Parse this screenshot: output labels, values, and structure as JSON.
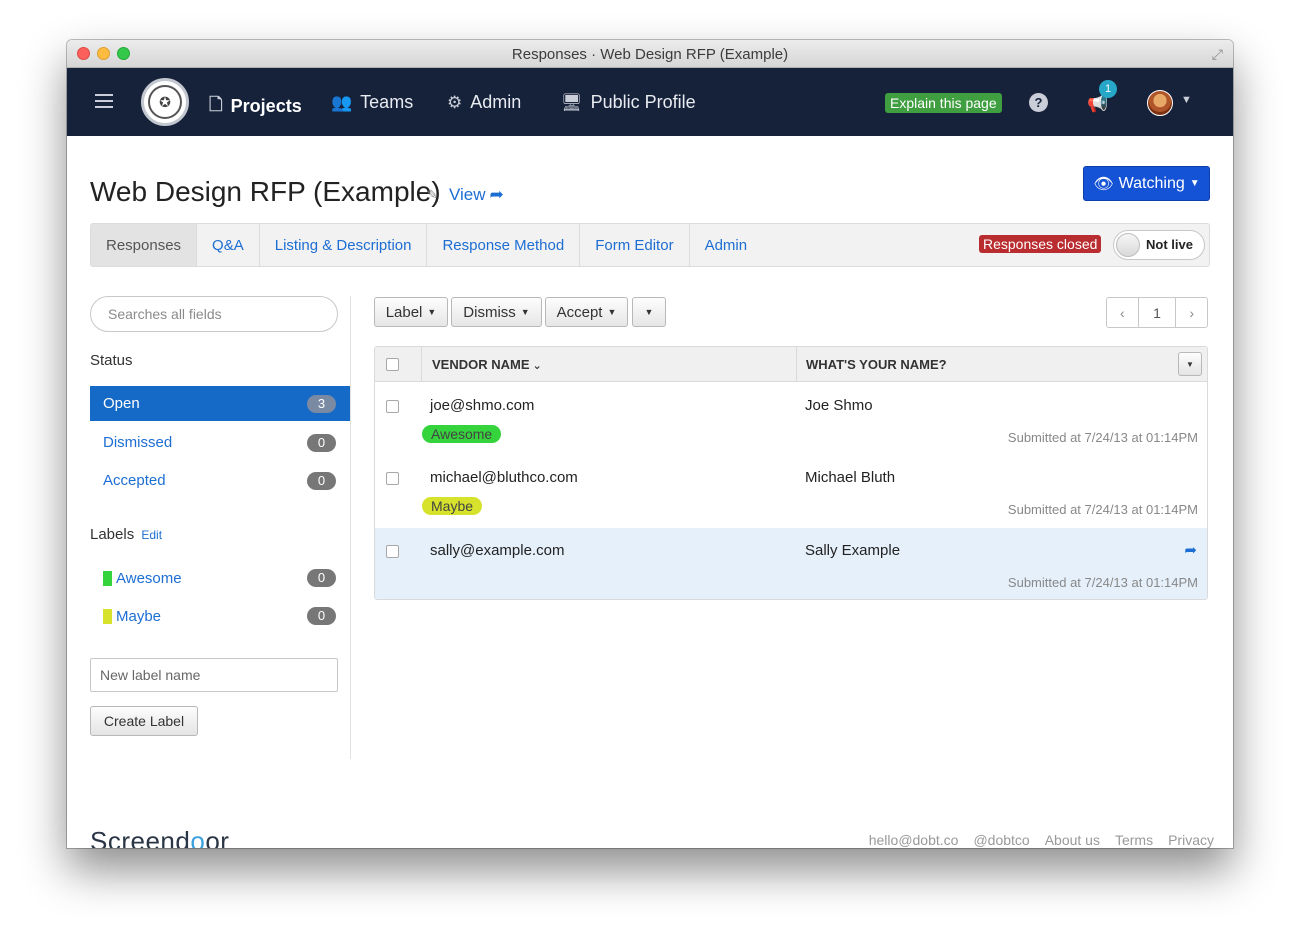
{
  "window": {
    "title": "Responses · Web Design RFP (Example)"
  },
  "navbar": {
    "items": [
      {
        "label": "Projects",
        "icon": "file-icon"
      },
      {
        "label": "Teams",
        "icon": "team-icon"
      },
      {
        "label": "Admin",
        "icon": "gear-icon"
      },
      {
        "label": "Public Profile",
        "icon": "monitor-icon"
      }
    ],
    "explain_label": "Explain this page",
    "notification_count": "1"
  },
  "header": {
    "title": "Web Design RFP (Example)",
    "view_label": "View",
    "watch_label": "Watching"
  },
  "tabs": [
    {
      "label": "Responses",
      "active": true
    },
    {
      "label": "Q&A"
    },
    {
      "label": "Listing & Description"
    },
    {
      "label": "Response Method"
    },
    {
      "label": "Form Editor"
    },
    {
      "label": "Admin"
    }
  ],
  "status_badge": "Responses closed",
  "live_toggle": "Not live",
  "sidebar": {
    "search_placeholder": "Searches all fields",
    "status_heading": "Status",
    "statuses": [
      {
        "label": "Open",
        "count": "3",
        "active": true
      },
      {
        "label": "Dismissed",
        "count": "0"
      },
      {
        "label": "Accepted",
        "count": "0"
      }
    ],
    "labels_heading": "Labels",
    "labels_edit": "Edit",
    "labels": [
      {
        "label": "Awesome",
        "count": "0",
        "color": "#35d43d"
      },
      {
        "label": "Maybe",
        "count": "0",
        "color": "#d6e22b"
      }
    ],
    "new_label_placeholder": "New label name",
    "create_label": "Create Label"
  },
  "toolbar": {
    "label_btn": "Label",
    "dismiss_btn": "Dismiss",
    "accept_btn": "Accept",
    "page": "1"
  },
  "table": {
    "columns": [
      "VENDOR NAME",
      "WHAT'S YOUR NAME?"
    ],
    "rows": [
      {
        "vendor": "joe@shmo.com",
        "name": "Joe Shmo",
        "tag": "Awesome",
        "tag_color": "#35d43d",
        "submitted": "Submitted at 7/24/13 at 01:14PM"
      },
      {
        "vendor": "michael@bluthco.com",
        "name": "Michael Bluth",
        "tag": "Maybe",
        "tag_color": "#d6e22b",
        "submitted": "Submitted at 7/24/13 at 01:14PM"
      },
      {
        "vendor": "sally@example.com",
        "name": "Sally Example",
        "tag": "",
        "submitted": "Submitted at 7/24/13 at 01:14PM"
      }
    ]
  },
  "footer": {
    "brand_prefix": "Screend",
    "brand_mid": "o",
    "brand_suffix": "or",
    "links": [
      "hello@dobt.co",
      "@dobtco",
      "About us",
      "Terms",
      "Privacy"
    ]
  }
}
